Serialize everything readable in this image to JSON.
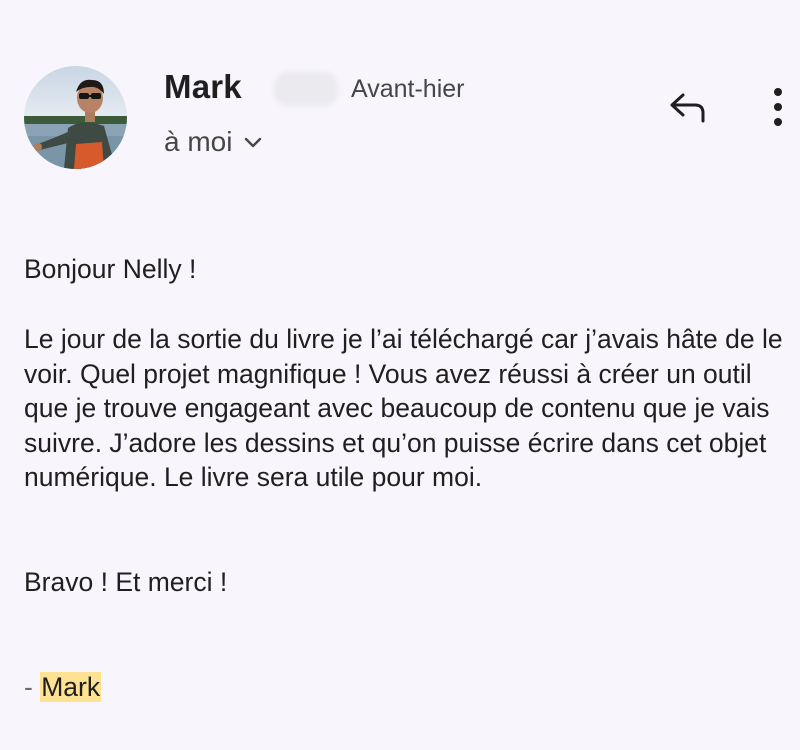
{
  "header": {
    "sender_name": "Mark",
    "date": "Avant-hier",
    "recipient_label": "à moi"
  },
  "icons": {
    "avatar": "profile-photo",
    "redacted": "redacted-email",
    "recipients": "chevron-down-icon",
    "reply": "reply-icon",
    "more": "more-vert-icon"
  },
  "message": {
    "greeting": "Bonjour Nelly !",
    "paragraph": "Le jour de la sortie du livre je l’ai téléchargé car j’avais hâte de le voir. Quel projet magnifique ! Vous avez réussi à créer un outil que je trouve engageant avec beaucoup de contenu que je vais suivre. J’adore les dessins et qu’on puisse écrire dans cet objet numérique. Le livre sera utile pour moi.",
    "closing": "Bravo ! Et merci !",
    "signature_dash": "- ",
    "signature_name": "Mark"
  },
  "colors": {
    "background": "#f8f6fc",
    "text": "#1f1f1f",
    "secondary_text": "#444746",
    "highlight": "#fde293"
  }
}
